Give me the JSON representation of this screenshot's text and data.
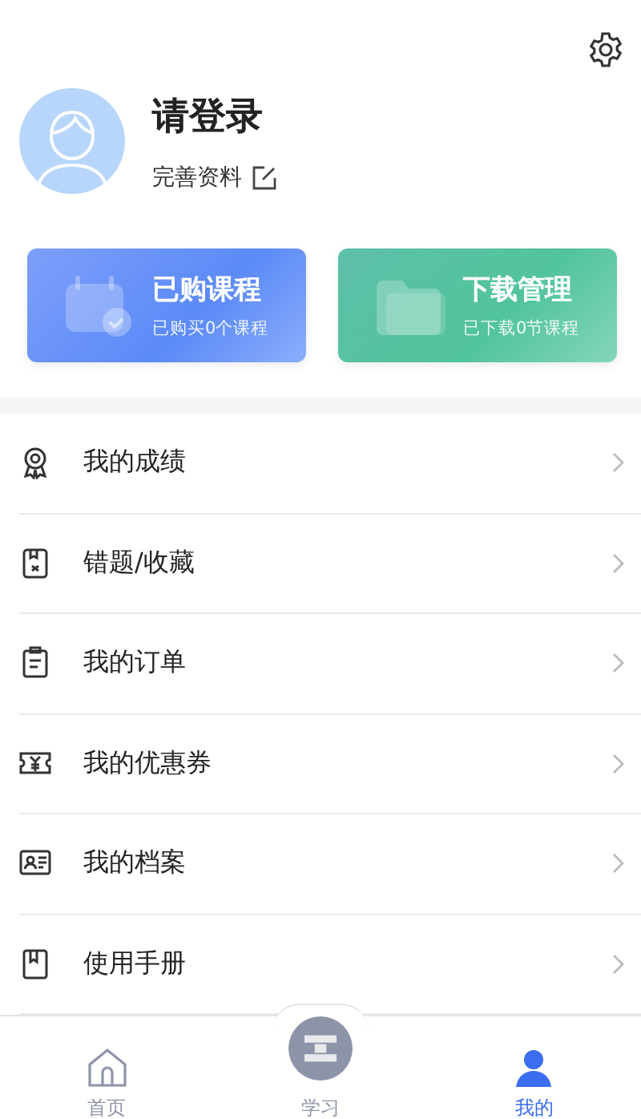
{
  "profile": {
    "name": "请登录",
    "edit_link": "完善资料"
  },
  "cards": [
    {
      "title": "已购课程",
      "subtitle": "已购买0个课程"
    },
    {
      "title": "下载管理",
      "subtitle": "已下载0节课程"
    }
  ],
  "menu": [
    {
      "label": "我的成绩"
    },
    {
      "label": "错题/收藏"
    },
    {
      "label": "我的订单"
    },
    {
      "label": "我的优惠券"
    },
    {
      "label": "我的档案"
    },
    {
      "label": "使用手册"
    }
  ],
  "tabs": [
    {
      "label": "首页",
      "selected": false
    },
    {
      "label": "学习",
      "selected": false
    },
    {
      "label": "我的",
      "selected": true
    }
  ]
}
